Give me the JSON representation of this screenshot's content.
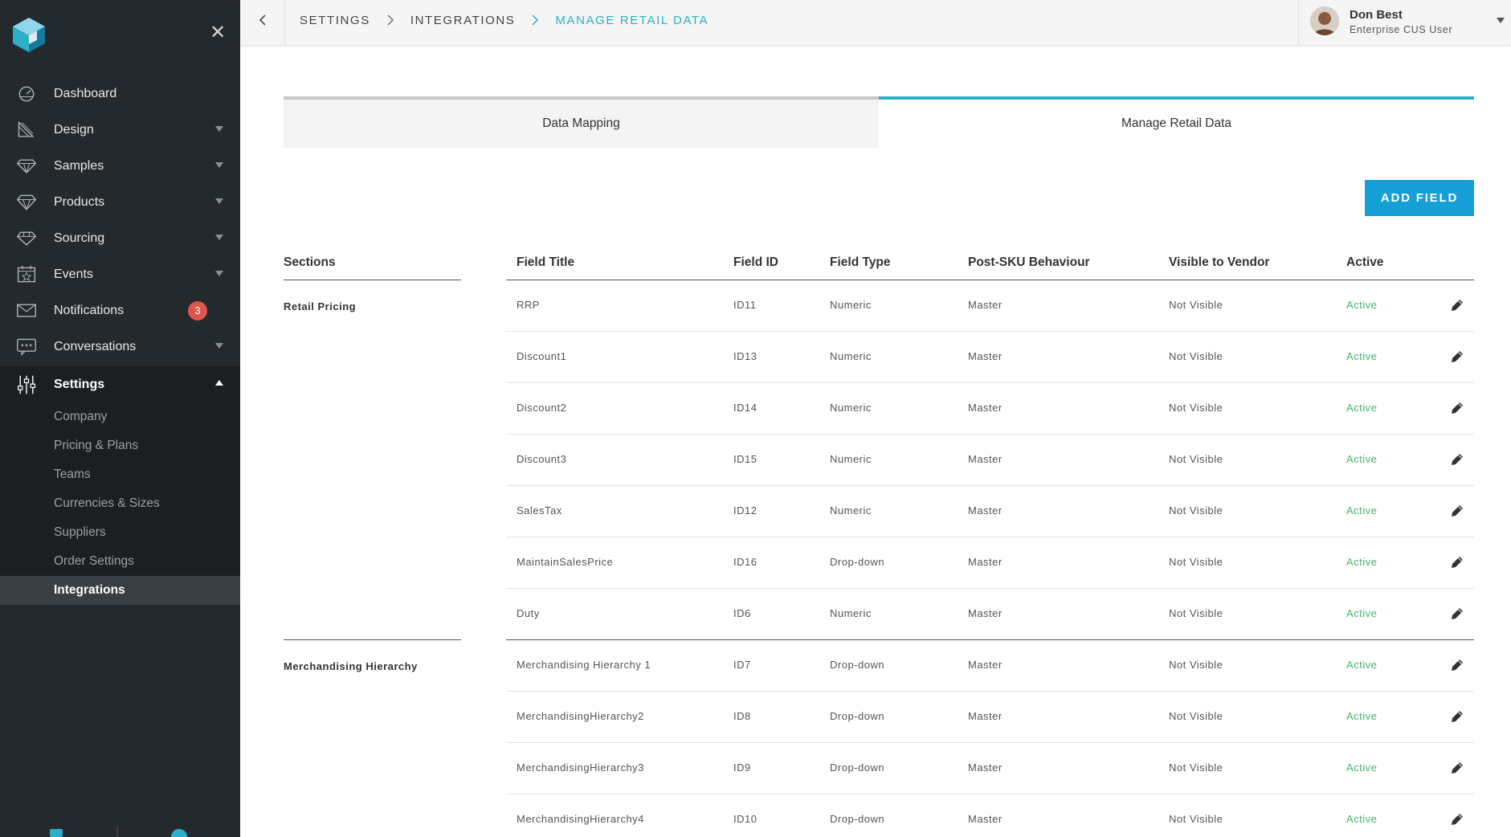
{
  "sidebar": {
    "items": [
      {
        "label": "Dashboard",
        "icon": "dashboard-icon"
      },
      {
        "label": "Design",
        "icon": "design-icon"
      },
      {
        "label": "Samples",
        "icon": "samples-icon"
      },
      {
        "label": "Products",
        "icon": "diamond-icon"
      },
      {
        "label": "Sourcing",
        "icon": "sourcing-icon"
      },
      {
        "label": "Events",
        "icon": "calendar-icon"
      },
      {
        "label": "Notifications",
        "icon": "envelope-icon",
        "badge": "3"
      },
      {
        "label": "Conversations",
        "icon": "chat-icon"
      },
      {
        "label": "Settings",
        "icon": "sliders-icon"
      }
    ],
    "settings_sub": [
      "Company",
      "Pricing & Plans",
      "Teams",
      "Currencies & Sizes",
      "Suppliers",
      "Order Settings",
      "Integrations"
    ],
    "badge_color": "#e0554b"
  },
  "breadcrumb": [
    "SETTINGS",
    "INTEGRATIONS",
    "MANAGE RETAIL DATA"
  ],
  "user": {
    "name": "Don Best",
    "role": "Enterprise CUS User"
  },
  "tabs": [
    "Data Mapping",
    "Manage Retail Data"
  ],
  "active_tab": "Manage Retail Data",
  "add_button": "ADD FIELD",
  "accent_color": "#2bb0c7",
  "button_color": "#169ed6",
  "table": {
    "headers": {
      "sections": "Sections",
      "field_title": "Field Title",
      "field_id": "Field ID",
      "field_type": "Field Type",
      "post_sku": "Post-SKU Behaviour",
      "visible": "Visible to Vendor",
      "active": "Active"
    },
    "sections": [
      {
        "name": "Retail Pricing",
        "rows": [
          {
            "title": "RRP",
            "id": "ID11",
            "type": "Numeric",
            "behaviour": "Master",
            "visible": "Not Visible",
            "active": "Active"
          },
          {
            "title": "Discount1",
            "id": "ID13",
            "type": "Numeric",
            "behaviour": "Master",
            "visible": "Not Visible",
            "active": "Active"
          },
          {
            "title": "Discount2",
            "id": "ID14",
            "type": "Numeric",
            "behaviour": "Master",
            "visible": "Not Visible",
            "active": "Active"
          },
          {
            "title": "Discount3",
            "id": "ID15",
            "type": "Numeric",
            "behaviour": "Master",
            "visible": "Not Visible",
            "active": "Active"
          },
          {
            "title": "SalesTax",
            "id": "ID12",
            "type": "Numeric",
            "behaviour": "Master",
            "visible": "Not Visible",
            "active": "Active"
          },
          {
            "title": "MaintainSalesPrice",
            "id": "ID16",
            "type": "Drop-down",
            "behaviour": "Master",
            "visible": "Not Visible",
            "active": "Active"
          },
          {
            "title": "Duty",
            "id": "ID6",
            "type": "Numeric",
            "behaviour": "Master",
            "visible": "Not Visible",
            "active": "Active"
          }
        ]
      },
      {
        "name": "Merchandising Hierarchy",
        "rows": [
          {
            "title": "Merchandising Hierarchy 1",
            "id": "ID7",
            "type": "Drop-down",
            "behaviour": "Master",
            "visible": "Not Visible",
            "active": "Active"
          },
          {
            "title": "MerchandisingHierarchy2",
            "id": "ID8",
            "type": "Drop-down",
            "behaviour": "Master",
            "visible": "Not Visible",
            "active": "Active"
          },
          {
            "title": "MerchandisingHierarchy3",
            "id": "ID9",
            "type": "Drop-down",
            "behaviour": "Master",
            "visible": "Not Visible",
            "active": "Active"
          },
          {
            "title": "MerchandisingHierarchy4",
            "id": "ID10",
            "type": "Drop-down",
            "behaviour": "Master",
            "visible": "Not Visible",
            "active": "Active"
          }
        ]
      }
    ]
  }
}
